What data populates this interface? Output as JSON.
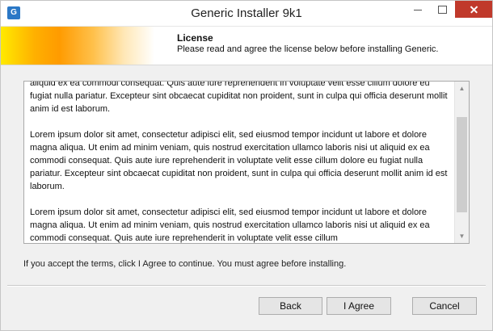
{
  "window": {
    "title": "Generic Installer 9k1",
    "icon_glyph": "G",
    "icon": "installer-app-icon",
    "controls": {
      "minimize_icon": "minimize-icon",
      "maximize_icon": "maximize-icon",
      "close_icon": "close-icon"
    }
  },
  "header": {
    "title": "License",
    "subtitle": "Please read and agree the license below before installing Generic."
  },
  "license": {
    "paragraphs": [
      "aliquid ex ea commodi consequat. Quis aute iure reprehenderit in voluptate velit esse cillum dolore eu fugiat nulla pariatur. Excepteur sint obcaecat cupiditat non proident, sunt in culpa qui officia deserunt mollit anim id est laborum.",
      "Lorem ipsum dolor sit amet, consectetur adipisci elit, sed eiusmod tempor incidunt ut labore et dolore magna aliqua. Ut enim ad minim veniam, quis nostrud exercitation ullamco laboris nisi ut aliquid ex ea commodi consequat. Quis aute iure reprehenderit in voluptate velit esse cillum dolore eu fugiat nulla pariatur. Excepteur sint obcaecat cupiditat non proident, sunt in culpa qui officia deserunt mollit anim id est laborum.",
      "Lorem ipsum dolor sit amet, consectetur adipisci elit, sed eiusmod tempor incidunt ut labore et dolore magna aliqua. Ut enim ad minim veniam, quis nostrud exercitation ullamco laboris nisi ut aliquid ex ea commodi consequat. Quis aute iure reprehenderit in voluptate velit esse cillum"
    ],
    "scroll_up_icon": "scroll-up-arrow-icon",
    "scroll_down_icon": "scroll-down-arrow-icon"
  },
  "instruction": "If you accept the terms, click I Agree to continue. You must agree before installing.",
  "buttons": {
    "back": "Back",
    "agree": "I Agree",
    "cancel": "Cancel"
  },
  "colors": {
    "close_button": "#c0392b",
    "banner_start": "#ffea00",
    "banner_mid": "#ff9b00"
  }
}
